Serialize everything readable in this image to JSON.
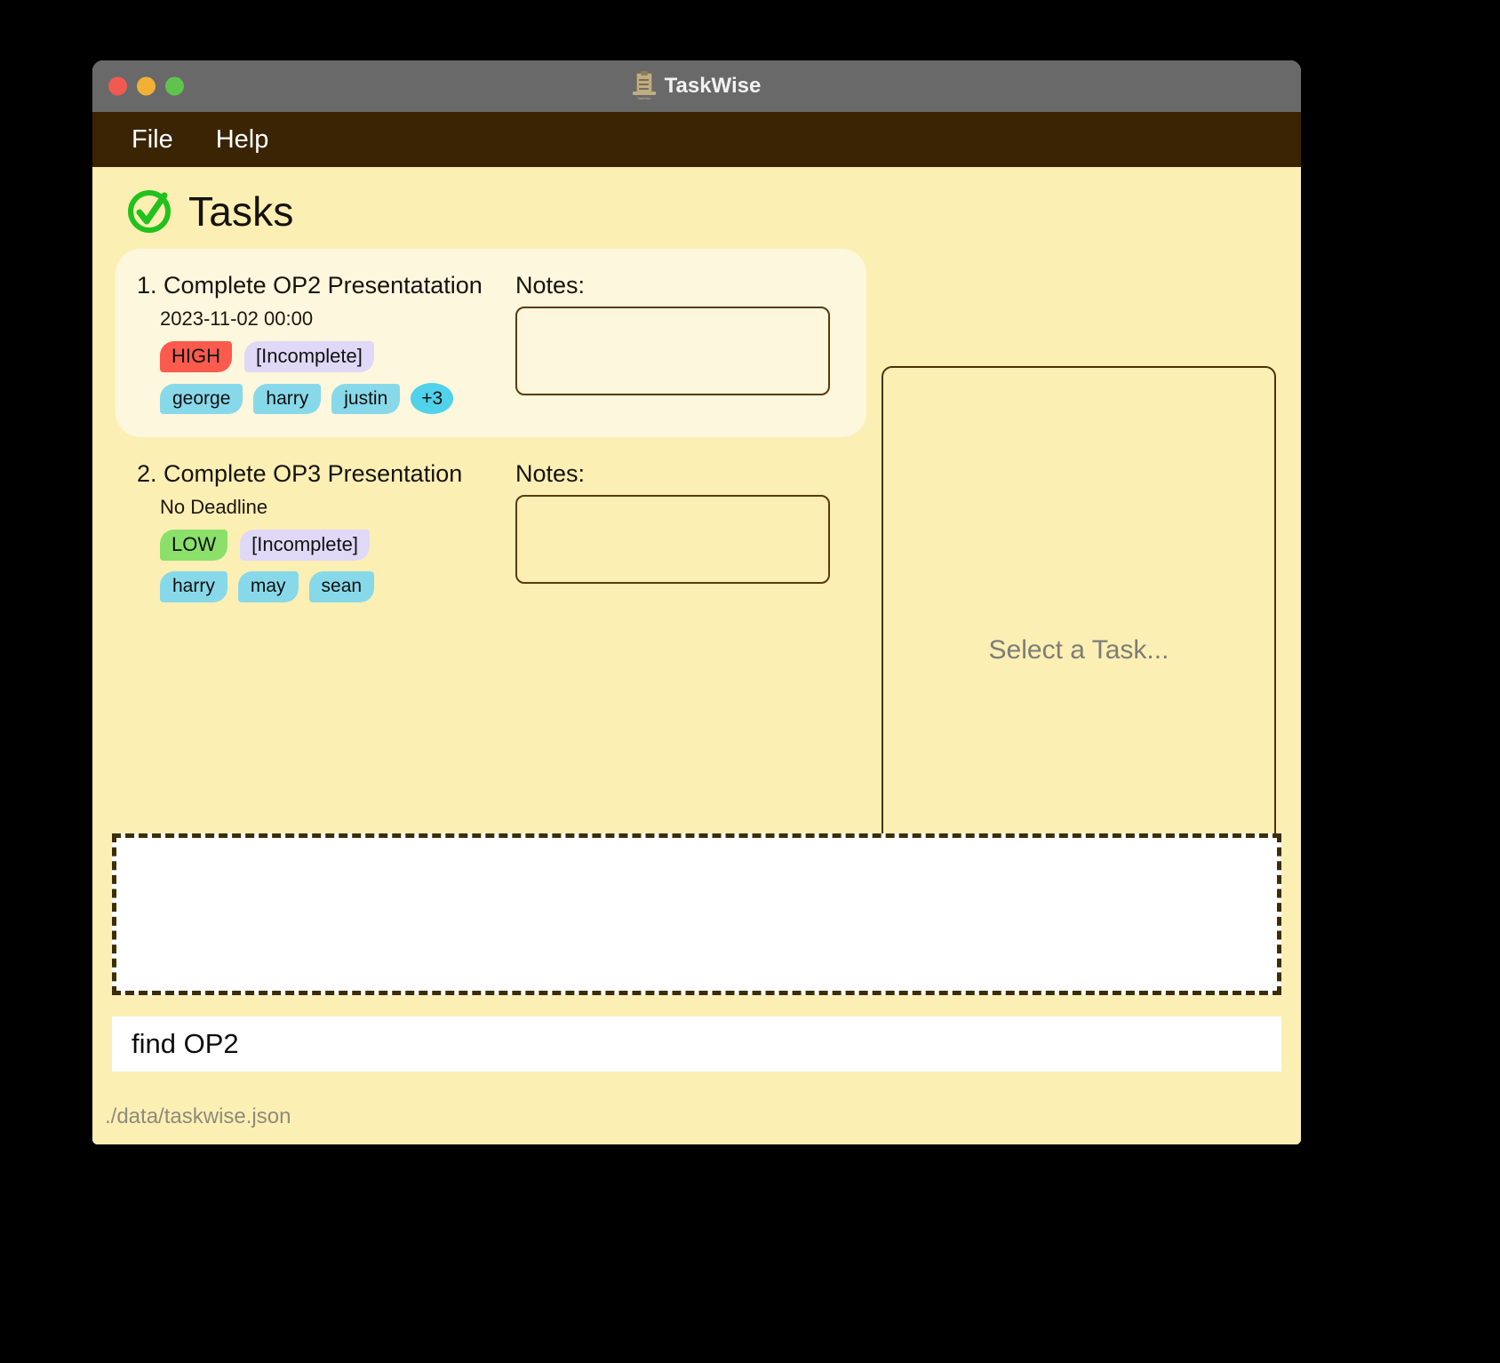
{
  "window": {
    "title": "TaskWise",
    "title_icon": "clipboard-icon",
    "traffic_lights": [
      "close",
      "minimize",
      "zoom"
    ]
  },
  "menubar": {
    "items": [
      {
        "label": "File"
      },
      {
        "label": "Help"
      }
    ]
  },
  "header": {
    "icon": "check-circle-icon",
    "title": "Tasks"
  },
  "tasks": [
    {
      "index": "1.",
      "title": "Complete OP2 Presentatation",
      "deadline": "2023-11-02 00:00",
      "priority": "HIGH",
      "priority_color": "#FB5B4C",
      "status": "[Incomplete]",
      "status_color": "#E0D8F7",
      "assignees": [
        "george",
        "harry",
        "justin"
      ],
      "overflow": "+3",
      "notes_label": "Notes:",
      "notes_value": "",
      "selected": true
    },
    {
      "index": "2.",
      "title": "Complete OP3 Presentation",
      "deadline": "No Deadline",
      "priority": "LOW",
      "priority_color": "#8BE06A",
      "status": "[Incomplete]",
      "status_color": "#E0D8F7",
      "assignees": [
        "harry",
        "may",
        "sean"
      ],
      "overflow": "",
      "notes_label": "Notes:",
      "notes_value": "",
      "selected": false
    }
  ],
  "detail_panel": {
    "placeholder": "Select a Task..."
  },
  "output": {
    "text": ""
  },
  "command": {
    "value": "find OP2",
    "placeholder": ""
  },
  "statusbar": {
    "path": "./data/taskwise.json"
  },
  "colors": {
    "window_chrome": "#696969",
    "menubar": "#3B2404",
    "page_background": "#FCEFB4",
    "selected_task": "#FCF7DD",
    "border": "#4A3104",
    "chip": "#87D9EA",
    "chip_more": "#4FD2EA"
  }
}
